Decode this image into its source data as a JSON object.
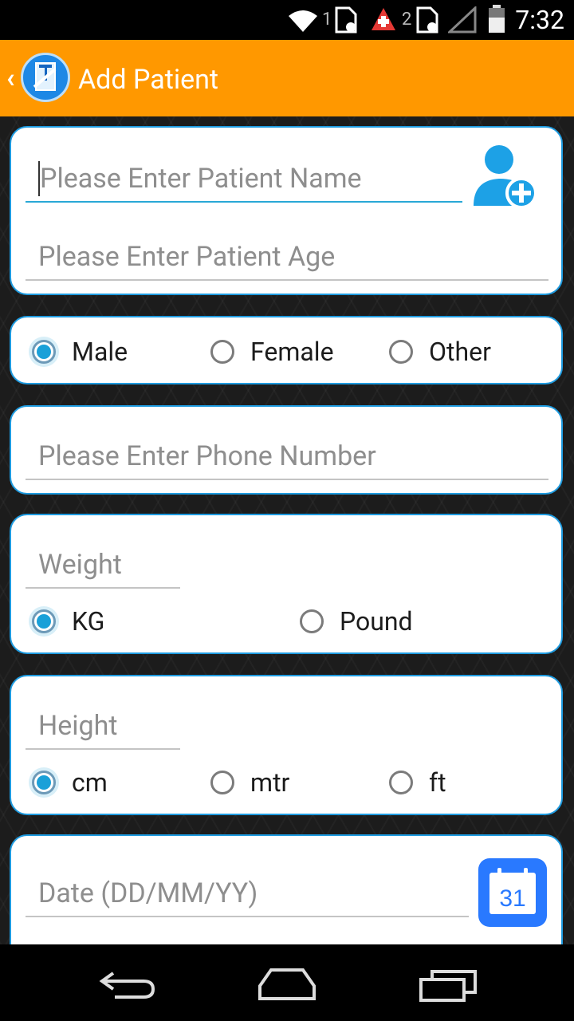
{
  "status_bar": {
    "time": "7:32",
    "sim1_label": "1",
    "sim2_label": "2"
  },
  "app_bar": {
    "title": "Add Patient"
  },
  "form": {
    "name_placeholder": "Please Enter Patient Name",
    "age_placeholder": "Please Enter Patient Age",
    "gender_options": [
      "Male",
      "Female",
      "Other"
    ],
    "gender_selected": "Male",
    "phone_placeholder": "Please Enter Phone Number",
    "weight_placeholder": "Weight",
    "weight_units": [
      "KG",
      "Pound"
    ],
    "weight_unit_selected": "KG",
    "height_placeholder": "Height",
    "height_units": [
      "cm",
      "mtr",
      "ft"
    ],
    "height_unit_selected": "cm",
    "date_placeholder": "Date (DD/MM/YY)",
    "calendar_day": "31"
  },
  "colors": {
    "accent": "#ff9800",
    "primary": "#1e9be0",
    "radio_on": "#1aa0d8"
  }
}
